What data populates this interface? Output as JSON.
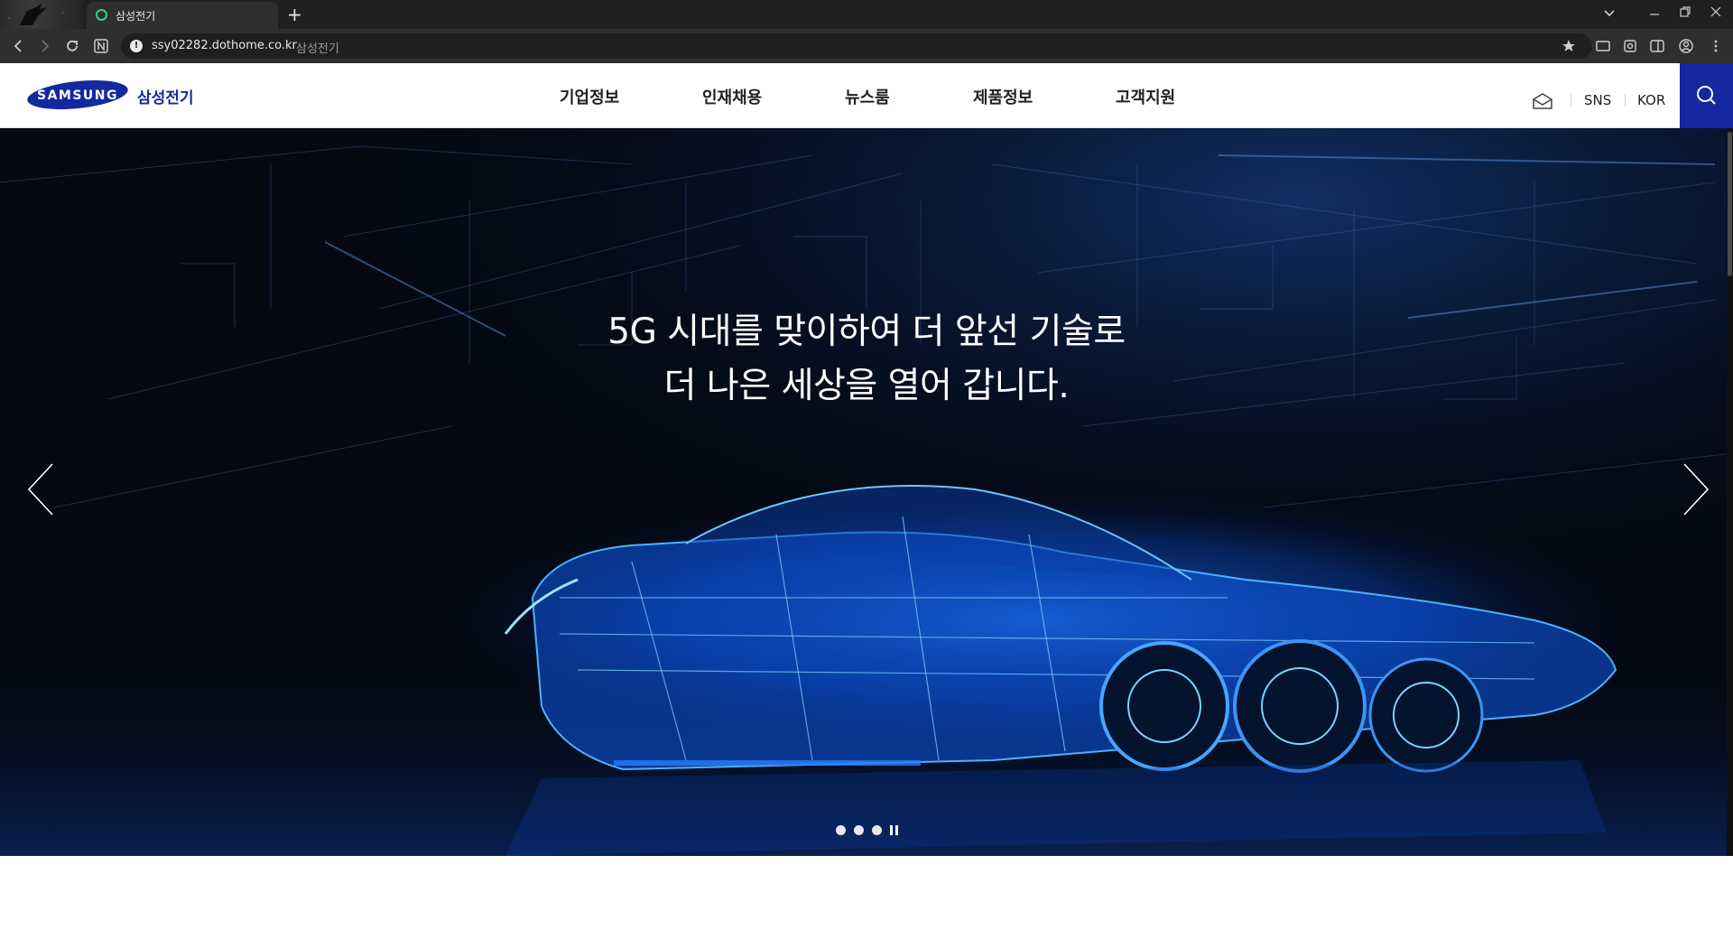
{
  "browser": {
    "tab_title": "삼성전기",
    "new_tab": "+",
    "url": "ssy02282.dothome.co.kr",
    "url_title": "삼성전기"
  },
  "header": {
    "logo_text": "SAMSUNG",
    "brand_ko": "삼성전기",
    "nav": [
      "기업정보",
      "인재채용",
      "뉴스룸",
      "제품정보",
      "고객지원"
    ],
    "util": {
      "sns": "SNS",
      "lang": "KOR"
    }
  },
  "hero": {
    "line1": "5G 시대를 맞이하여 더 앞선 기술로",
    "line2": "더 나은 세상을 열어 갑니다.",
    "slides": 3,
    "active_slide": 1
  },
  "colors": {
    "brand_blue": "#1428a0",
    "hero_bg": "#020610",
    "glow_blue": "#1e7bff"
  }
}
